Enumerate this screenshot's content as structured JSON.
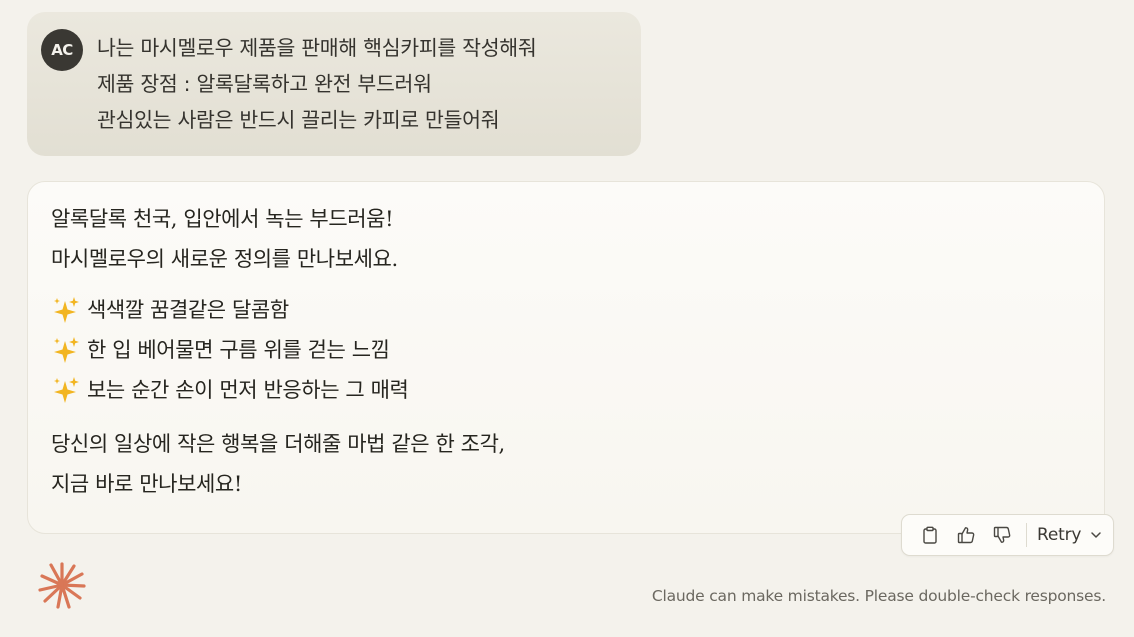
{
  "user_message": {
    "avatar_initials": "AC",
    "lines": [
      "나는 마시멜로우 제품을 판매해 핵심카피를 작성해줘",
      "제품 장점 : 알록달록하고 완전 부드러워",
      "관심있는 사람은 반드시 끌리는 카피로 만들어줘"
    ]
  },
  "assistant_response": {
    "intro_lines": [
      "알록달록 천국, 입안에서 녹는 부드러움!",
      "마시멜로우의 새로운 정의를 만나보세요."
    ],
    "bullets": [
      {
        "icon": "sparkles-icon",
        "text": "색색깔 꿈결같은 달콤함"
      },
      {
        "icon": "sparkles-icon",
        "text": "한 입 베어물면 구름 위를 걷는 느낌"
      },
      {
        "icon": "sparkles-icon",
        "text": "보는 순간 손이 먼저 반응하는 그 매력"
      }
    ],
    "closing_lines": [
      "당신의 일상에 작은 행복을 더해줄 마법 같은 한 조각,",
      "지금 바로 만나보세요!"
    ]
  },
  "toolbar": {
    "copy_icon": "clipboard-icon",
    "thumbs_up_icon": "thumbs-up-icon",
    "thumbs_down_icon": "thumbs-down-icon",
    "retry_label": "Retry",
    "retry_icon": "chevron-down-icon"
  },
  "footer": {
    "disclaimer": "Claude can make mistakes. Please double-check responses."
  },
  "colors": {
    "background": "#f4f2ec",
    "user_bubble": "#e7e4da",
    "avatar": "#3a3833",
    "logo_accent": "#d97757",
    "sparkle": "#f2b521"
  }
}
